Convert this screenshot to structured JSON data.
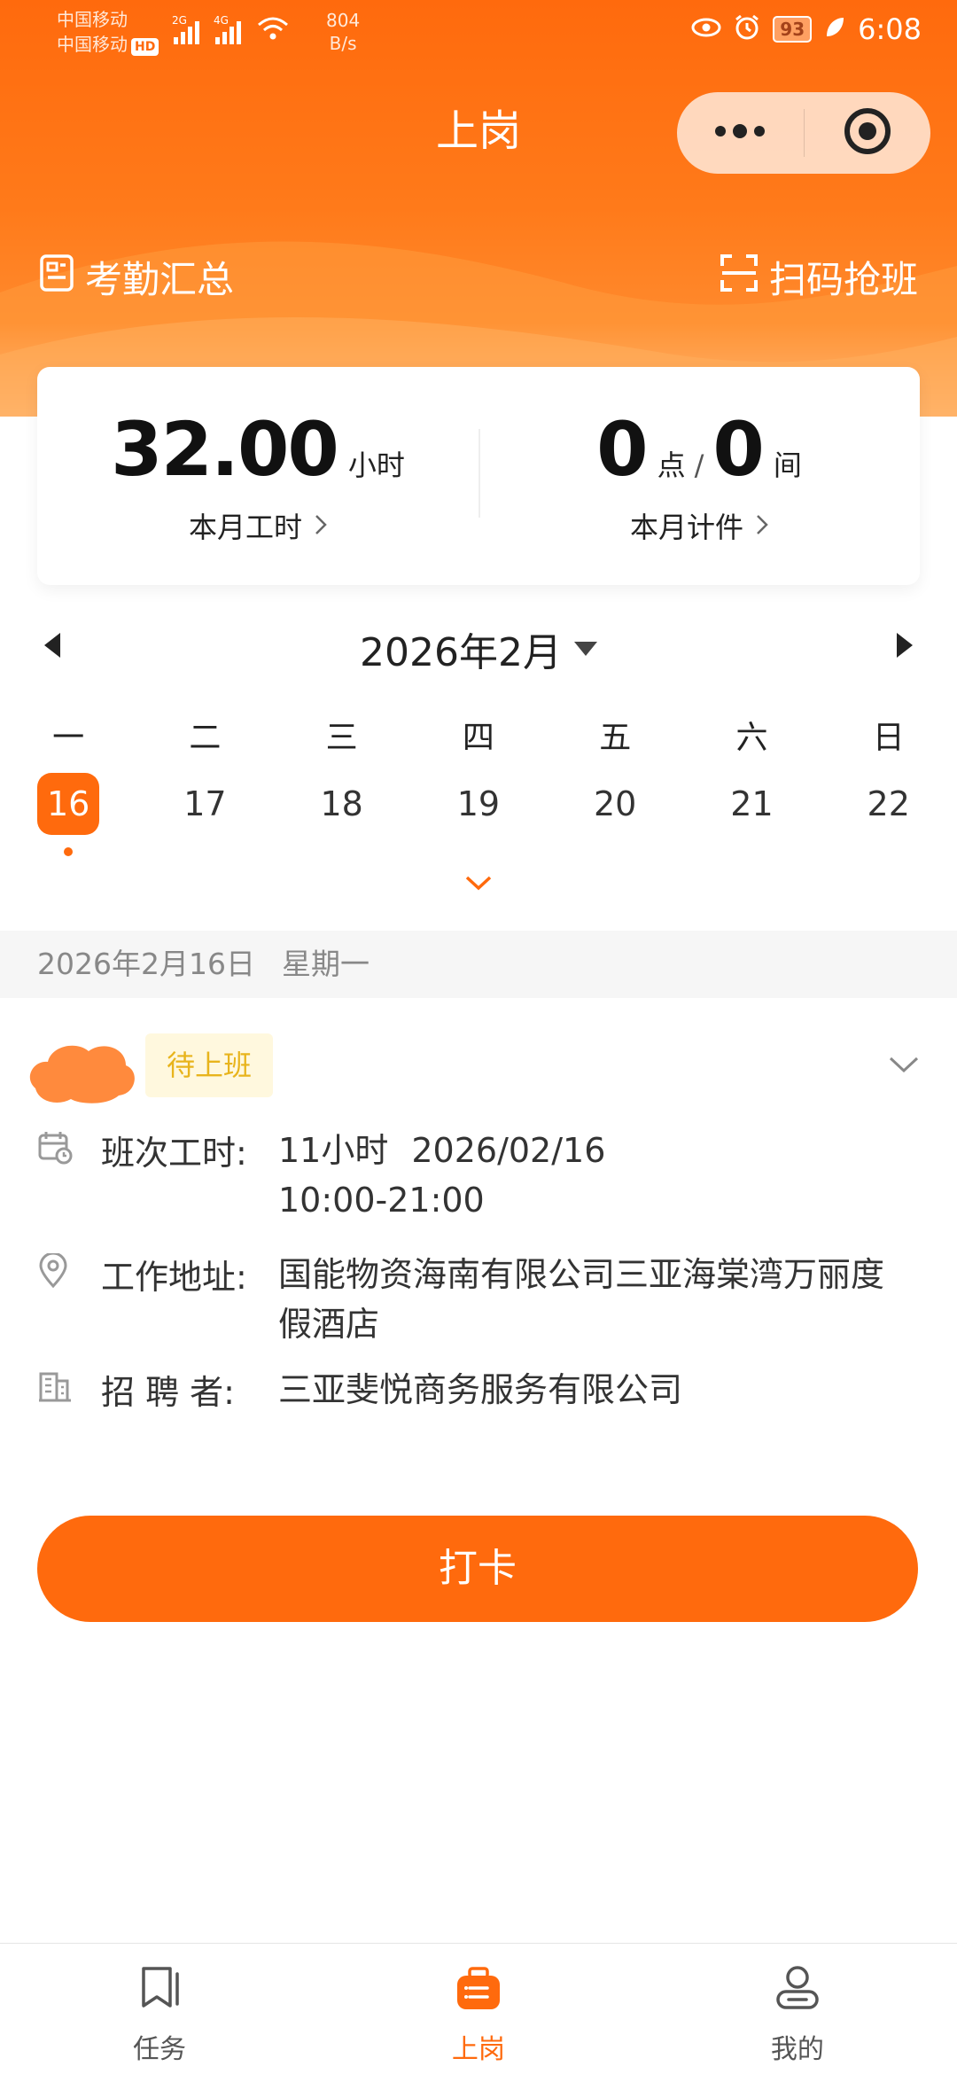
{
  "status_bar": {
    "carrier_1": "中国移动",
    "carrier_2": "中国移动",
    "hd_badge": "HD",
    "net_1": "2G",
    "net_2": "4G",
    "speed_value": "804",
    "speed_unit": "B/s",
    "battery": "93",
    "time": "6:08"
  },
  "header": {
    "title": "上岗",
    "capsule_more": "more-icon",
    "capsule_close": "target-icon"
  },
  "quick_actions": {
    "attendance_summary": "考勤汇总",
    "scan_grab_shift": "扫码抢班"
  },
  "stats": {
    "hours_value": "32.00",
    "hours_unit": "小时",
    "hours_label": "本月工时",
    "pieces_points": "0",
    "pieces_points_unit": "点",
    "pieces_separator": "/",
    "pieces_rooms": "0",
    "pieces_rooms_unit": "间",
    "pieces_label": "本月计件"
  },
  "calendar": {
    "month_label": "2026年2月",
    "weekdays": [
      "一",
      "二",
      "三",
      "四",
      "五",
      "六",
      "日"
    ],
    "dates": [
      "16",
      "17",
      "18",
      "19",
      "20",
      "21",
      "22"
    ],
    "selected_index": 0
  },
  "selected_date": {
    "date": "2026年2月16日",
    "weekday": "星期一"
  },
  "shift": {
    "status_badge": "待上班",
    "schedule_label": "班次工时:",
    "schedule_hours": "11小时",
    "schedule_date": "2026/02/16",
    "schedule_time": "10:00-21:00",
    "address_label": "工作地址:",
    "address_value": "国能物资海南有限公司三亚海棠湾万丽度假酒店",
    "recruiter_label": "招 聘 者:",
    "recruiter_value": "三亚斐悦商务服务有限公司"
  },
  "punch_button": "打卡",
  "tabbar": {
    "tasks": "任务",
    "on_duty": "上岗",
    "mine": "我的"
  },
  "colors": {
    "accent": "#ff6a0d",
    "badge_bg": "#fff8de",
    "badge_text": "#e8b41c"
  }
}
